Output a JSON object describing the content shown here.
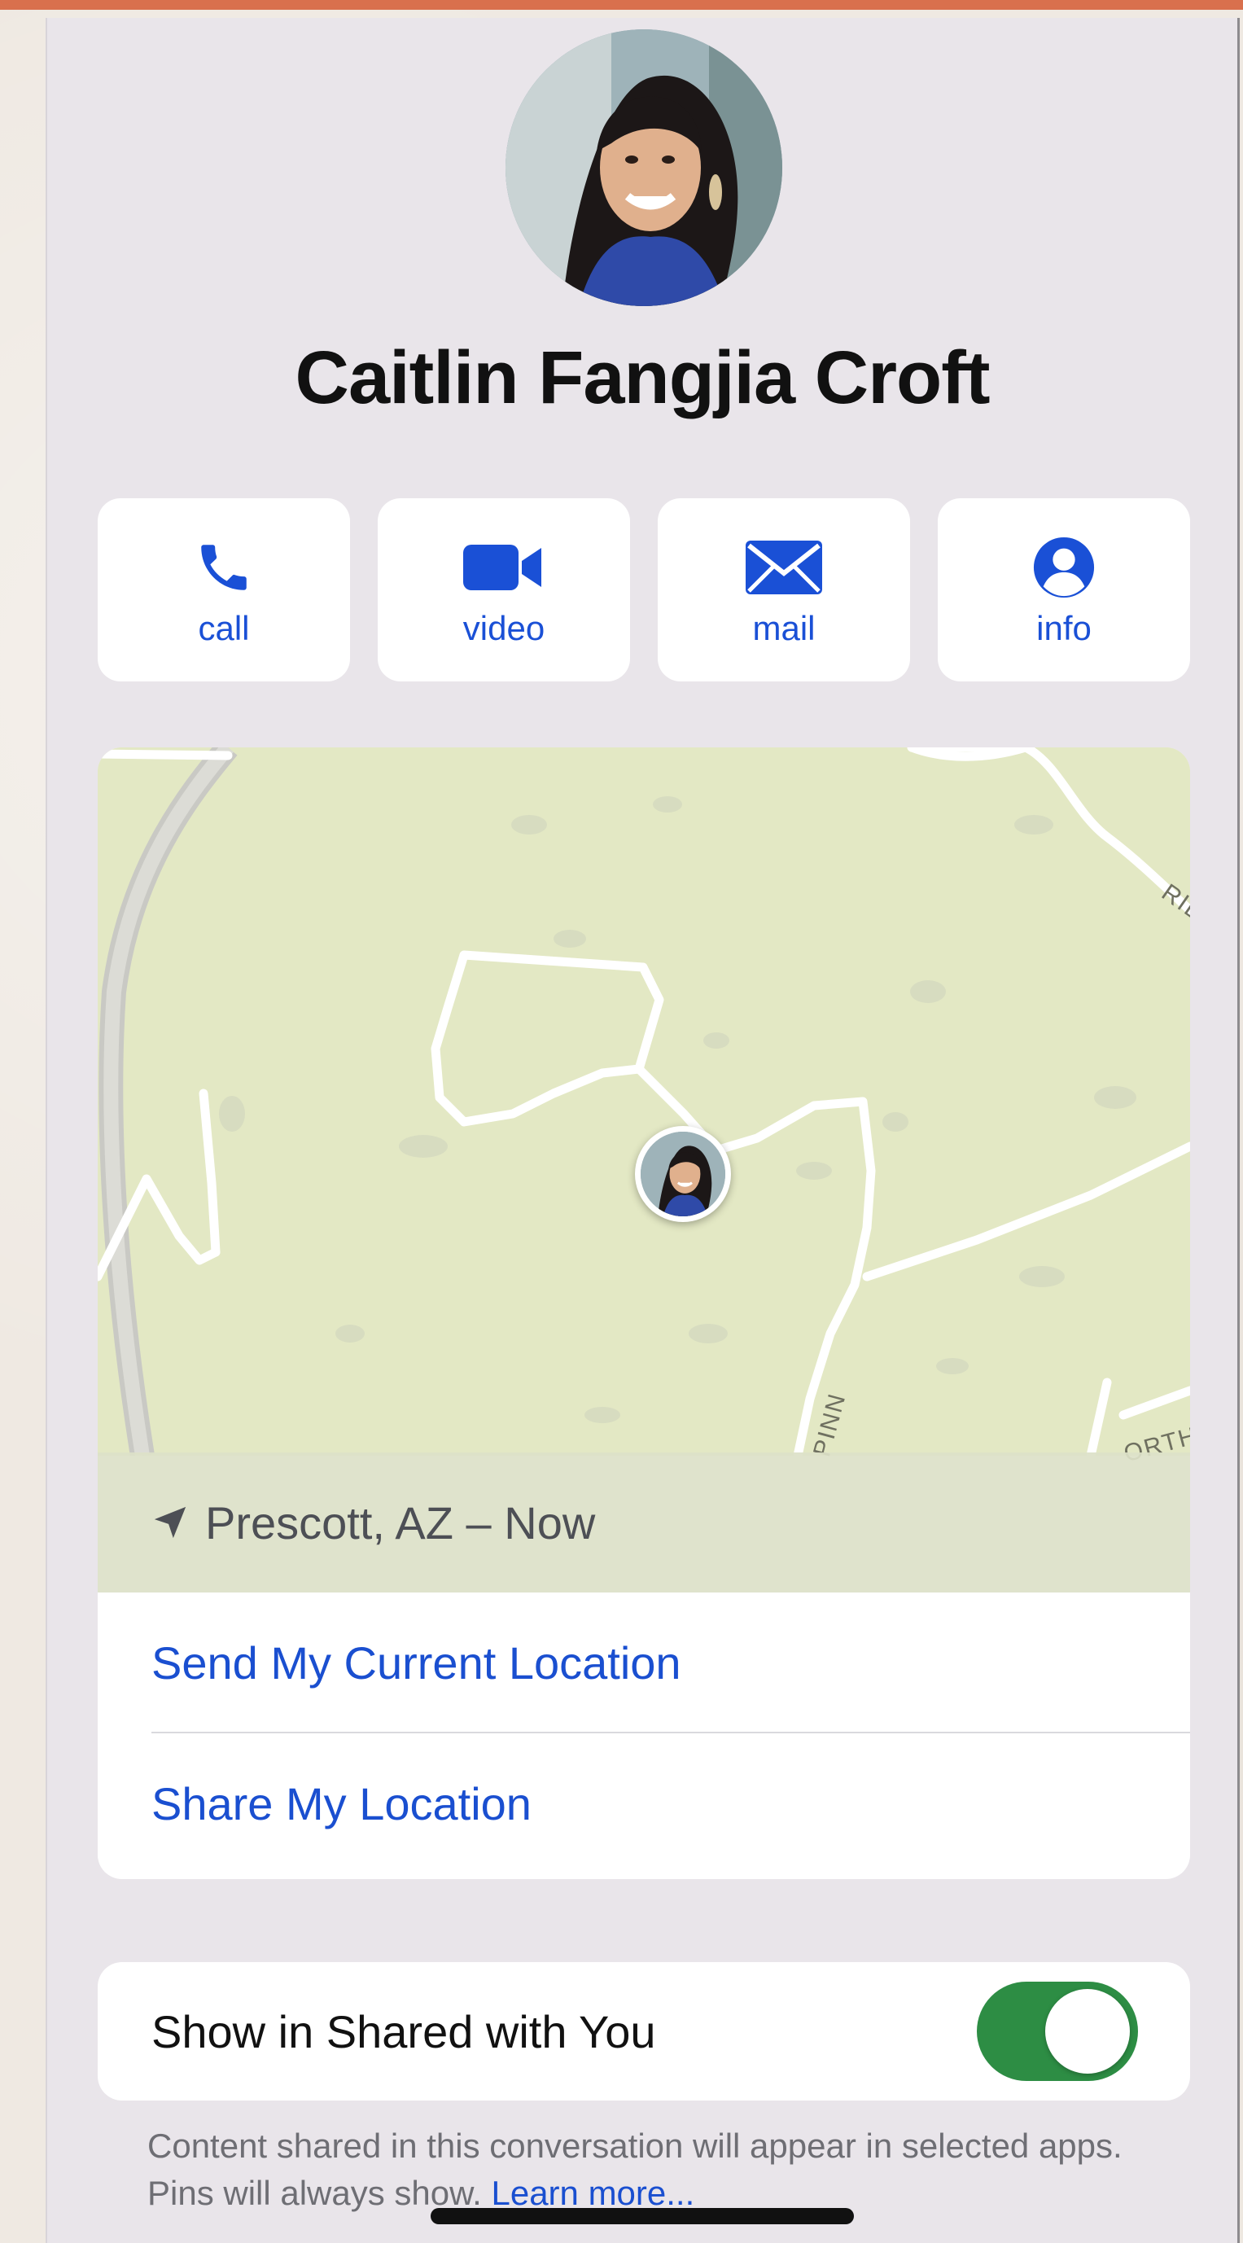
{
  "contact": {
    "name": "Caitlin Fangjia Croft"
  },
  "actions": [
    {
      "label": "call",
      "icon": "phone-icon"
    },
    {
      "label": "video",
      "icon": "video-camera-icon"
    },
    {
      "label": "mail",
      "icon": "envelope-icon"
    },
    {
      "label": "info",
      "icon": "person-circle-icon"
    }
  ],
  "map": {
    "road_labels": [
      "RID",
      "PINN",
      "ORTH"
    ],
    "location_text": "Prescott, AZ – Now"
  },
  "location_actions": {
    "send_current": "Send My Current Location",
    "share": "Share My Location"
  },
  "shared_with_you": {
    "label": "Show in Shared with You",
    "toggle_on": true,
    "footnote": "Content shared in this conversation will appear in selected apps. Pins will always show.",
    "learn_more": "Learn more..."
  },
  "colors": {
    "accent_blue": "#1a50d6",
    "toggle_green": "#2d8d44",
    "map_green": "#e3e8c4",
    "screen_bg": "#e9e5ea"
  }
}
